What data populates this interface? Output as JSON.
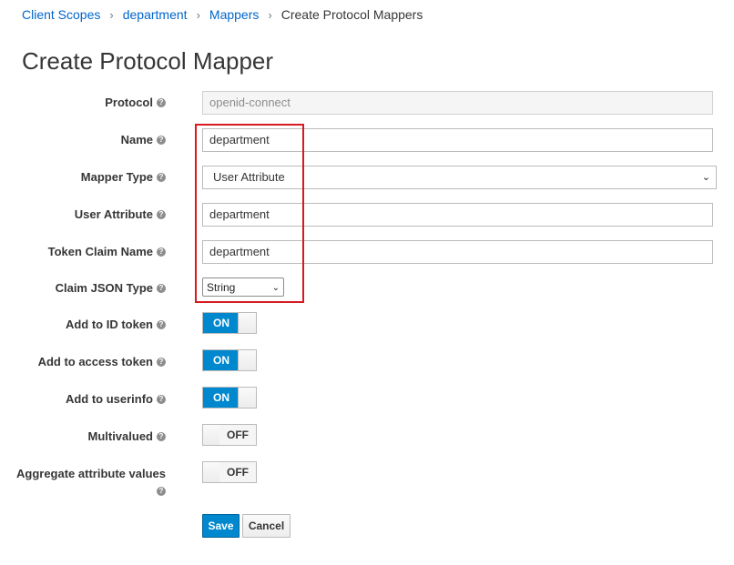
{
  "breadcrumb": {
    "items": [
      {
        "label": "Client Scopes"
      },
      {
        "label": "department"
      },
      {
        "label": "Mappers"
      }
    ],
    "current": "Create Protocol Mappers",
    "separator": "›"
  },
  "page": {
    "title": "Create Protocol Mapper"
  },
  "help_icon_glyph": "?",
  "form": {
    "protocol": {
      "label": "Protocol",
      "value": "openid-connect"
    },
    "name": {
      "label": "Name",
      "value": "department"
    },
    "mapper_type": {
      "label": "Mapper Type",
      "value": "User Attribute"
    },
    "user_attribute": {
      "label": "User Attribute",
      "value": "department"
    },
    "token_claim_name": {
      "label": "Token Claim Name",
      "value": "department"
    },
    "claim_json_type": {
      "label": "Claim JSON Type",
      "value": "String"
    },
    "add_to_id_token": {
      "label": "Add to ID token",
      "state": "ON"
    },
    "add_to_access_token": {
      "label": "Add to access token",
      "state": "ON"
    },
    "add_to_userinfo": {
      "label": "Add to userinfo",
      "state": "ON"
    },
    "multivalued": {
      "label": "Multivalued",
      "state": "OFF"
    },
    "aggregate_attribute_values": {
      "label": "Aggregate attribute values",
      "state": "OFF"
    }
  },
  "actions": {
    "save_label": "Save",
    "cancel_label": "Cancel"
  },
  "colors": {
    "primary": "#0088ce",
    "link": "#0066cc",
    "highlight": "#d71920"
  }
}
